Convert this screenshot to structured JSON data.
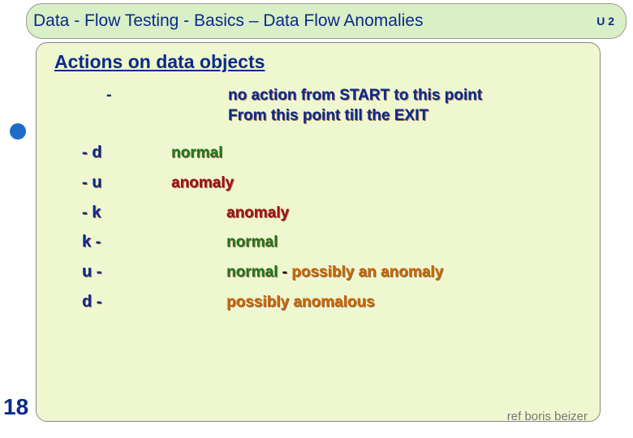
{
  "header": {
    "title": "Data - Flow Testing   -  Basics – Data Flow Anomalies",
    "badge": "U 2"
  },
  "side_number": "18",
  "subtitle": "Actions on data objects",
  "intro": {
    "symbol": "-",
    "line1": "no action from START to this point",
    "line2": "From this point till the EXIT"
  },
  "rows": [
    {
      "sym": "- d",
      "status": "normal",
      "status_color": "green",
      "gap": "a",
      "extra": ""
    },
    {
      "sym": "- u",
      "status": "anomaly",
      "status_color": "red",
      "gap": "a",
      "extra": ""
    },
    {
      "sym": "- k",
      "status": "anomaly",
      "status_color": "red",
      "gap": "b",
      "extra": ""
    },
    {
      "sym": "k -",
      "status": "normal",
      "status_color": "green",
      "gap": "b",
      "extra": ""
    },
    {
      "sym": "u -",
      "status": "normal",
      "status_color": "green",
      "gap": "b",
      "extra": "possibly an anomaly",
      "extra_color": "orange",
      "sep": " - "
    },
    {
      "sym": "d -",
      "status": "possibly anomalous",
      "status_color": "orange",
      "gap": "b",
      "extra": ""
    }
  ],
  "footer": "ref boris beizer"
}
